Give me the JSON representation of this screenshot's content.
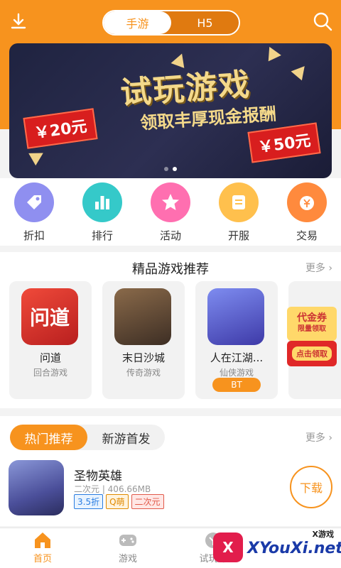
{
  "header": {
    "tabs": [
      {
        "label": "手游",
        "active": true
      },
      {
        "label": "H5",
        "active": false
      }
    ],
    "accent": "#f7931e"
  },
  "banner": {
    "title": "试玩游戏",
    "subtitle": "领取丰厚现金报酬",
    "left_tag": "￥20元",
    "right_tag": "￥50元",
    "dots": 2,
    "active_dot": 1
  },
  "quick_actions": [
    {
      "label": "折扣",
      "icon": "sale-tag-icon",
      "color": "#8f8ff0"
    },
    {
      "label": "排行",
      "icon": "bar-rank-icon",
      "color": "#35c9c9"
    },
    {
      "label": "活动",
      "icon": "star-icon",
      "color": "#ff6fb0"
    },
    {
      "label": "开服",
      "icon": "server-list-icon",
      "color": "#ffc04d"
    },
    {
      "label": "交易",
      "icon": "yuan-bag-icon",
      "color": "#ff8a3d"
    }
  ],
  "recommend": {
    "title": "精品游戏推荐",
    "more": "更多",
    "games": [
      {
        "name": "问道",
        "genre": "回合游戏",
        "badge": "",
        "art_text": "问道",
        "art_color": "#d9362e"
      },
      {
        "name": "末日沙城",
        "genre": "传奇游戏",
        "badge": "",
        "art_text": "",
        "art_color": "#5c4a3a"
      },
      {
        "name": "人在江湖...",
        "genre": "仙侠游戏",
        "badge": "BT",
        "art_text": "",
        "art_color": "#6a6bd8"
      }
    ],
    "promo": {
      "line1": "代金券",
      "line2": "限量领取",
      "button": "点击领取"
    }
  },
  "hot": {
    "tabs": [
      {
        "label": "热门推荐",
        "active": true
      },
      {
        "label": "新游首发",
        "active": false
      }
    ],
    "more": "更多",
    "items": [
      {
        "title": "圣物英雄",
        "meta": "二次元 | 406.66MB",
        "tags": [
          "3.5折",
          "Q萌",
          "二次元"
        ],
        "action": "下载"
      }
    ]
  },
  "bottom_nav": [
    {
      "label": "首页",
      "icon": "home-icon",
      "active": true
    },
    {
      "label": "游戏",
      "icon": "gamepad-icon",
      "active": false
    },
    {
      "label": "试玩赚",
      "icon": "trial-icon",
      "active": false
    }
  ],
  "watermark": {
    "small": "X游戏",
    "big": "XYouXi.net",
    "mark": "X"
  }
}
